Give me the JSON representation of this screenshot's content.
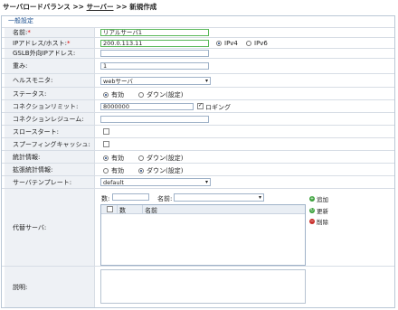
{
  "breadcrumb": {
    "part1": "サーバロードバランス >> ",
    "link": "サーバー",
    "part2": " >> 新規作成"
  },
  "section_title": "一般設定",
  "fields": {
    "name": {
      "label": "名前:",
      "required": "*",
      "value": "リアルサーバ1"
    },
    "ip": {
      "label": "IPアドレス/ホスト:",
      "required": "*",
      "value": "200.0.113.11",
      "opt_ipv4": "IPv4",
      "opt_ipv6": "IPv6"
    },
    "gslb": {
      "label": "GSLB外向IPアドレス:",
      "value": ""
    },
    "weight": {
      "label": "重み:",
      "value": "1"
    },
    "health": {
      "label": "ヘルスモニタ:",
      "value": "webサーバ"
    },
    "status": {
      "label": "ステータス:",
      "opt_on": "有効",
      "opt_off": "ダウン(設定)"
    },
    "conn_limit": {
      "label": "コネクションリミット:",
      "value": "8000000",
      "logging": "ロギング"
    },
    "conn_resume": {
      "label": "コネクションレジューム:",
      "value": ""
    },
    "slow_start": {
      "label": "スロースタート:"
    },
    "spoof_cache": {
      "label": "スプーフィングキャッシュ:"
    },
    "stats": {
      "label": "統計情報:",
      "opt_on": "有効",
      "opt_off": "ダウン(設定)"
    },
    "ext_stats": {
      "label": "拡張統計情報:",
      "opt_on": "有効",
      "opt_off": "ダウン(設定)"
    },
    "template": {
      "label": "サーバテンプレート:",
      "value": "default"
    },
    "alt": {
      "label": "代替サーバ:",
      "num_label": "数:",
      "name_label": "名前:",
      "col_num": "数",
      "col_name": "名前",
      "btn_add": "追加",
      "btn_update": "更新",
      "btn_delete": "削除"
    },
    "desc": {
      "label": "説明:"
    }
  }
}
